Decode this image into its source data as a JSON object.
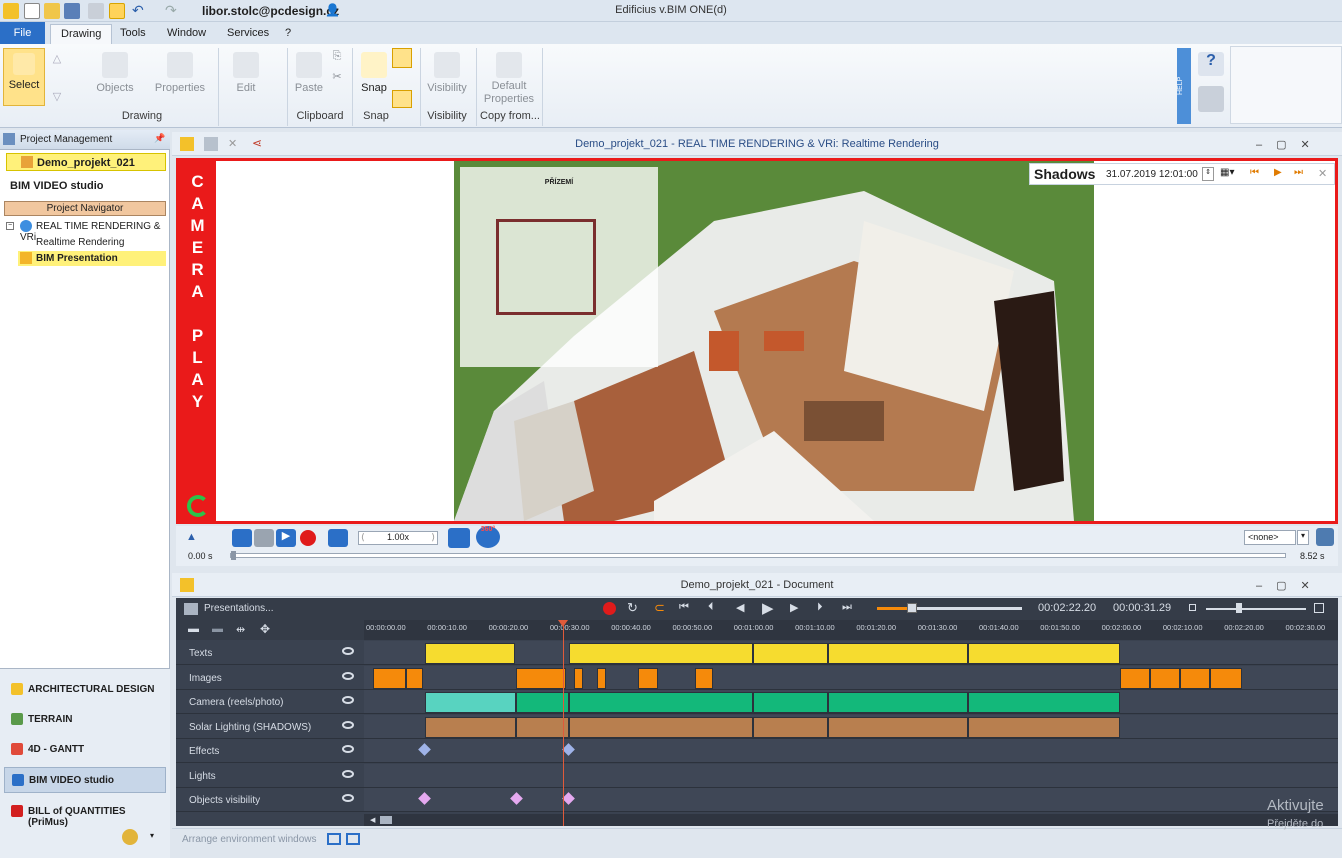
{
  "window": {
    "user_email": "libor.stolc@pcdesign.cz",
    "app_title": "Edificius v.BIM ONE(d)"
  },
  "menu": {
    "file": "File",
    "tabs": [
      "Drawing",
      "Tools",
      "Window",
      "Services",
      "?"
    ]
  },
  "ribbon": {
    "select": "Select",
    "objects": "Objects",
    "properties": "Properties",
    "edit": "Edit",
    "paste": "Paste",
    "snap": "Snap",
    "visibility": "Visibility",
    "default_properties_1": "Default",
    "default_properties_2": "Properties",
    "groups": {
      "drawing": "Drawing",
      "clipboard": "Clipboard",
      "snap": "Snap",
      "visibility": "Visibility",
      "copy_from": "Copy from..."
    },
    "help": "HELP"
  },
  "left_panel": {
    "header": "Project Management",
    "project": "Demo_projekt_021",
    "section": "BIM VIDEO studio",
    "navigator": "Project Navigator",
    "tree": [
      "REAL TIME RENDERING & VRi",
      "Realtime Rendering",
      "BIM Presentation"
    ],
    "modules": [
      "ARCHITECTURAL DESIGN",
      "TERRAIN",
      "4D - GANTT",
      "BIM VIDEO studio",
      "BILL of QUANTITIES (PriMus)"
    ]
  },
  "viewer": {
    "title": "Demo_projekt_021 -  REAL TIME RENDERING & VRi: Realtime Rendering",
    "camera_play": [
      "C",
      "A",
      "M",
      "E",
      "R",
      "A",
      "",
      "P",
      "L",
      "A",
      "Y"
    ],
    "shadows_label": "Shadows",
    "shadows_datetime": "31.07.2019  12:01:00",
    "floorplan_title": "PŘÍZEMÍ",
    "speed": "1.00x",
    "time_start": "0.00 s",
    "time_end": "8.52 s",
    "view_select": "<none>",
    "badge_360": "360°"
  },
  "timeline": {
    "title": "Demo_projekt_021 - Document",
    "presentations": "Presentations...",
    "time_current": "00:02:22.20",
    "time_total": "00:00:31.29",
    "ruler_labels": [
      "00:00:00.00",
      "00:00:10.00",
      "00:00:20.00",
      "00:00:30.00",
      "00:00:40.00",
      "00:00:50.00",
      "00:01:00.00",
      "00:01:10.00",
      "00:01:20.00",
      "00:01:30.00",
      "00:01:40.00",
      "00:01:50.00",
      "00:02:00.00",
      "00:02:10.00",
      "00:02:20.00",
      "00:02:30.00"
    ],
    "tracks": [
      "Texts",
      "Images",
      "Camera (reels/photo)",
      "Solar Lighting (SHADOWS)",
      "Effects",
      "Lights",
      "Objects visibility"
    ]
  },
  "status": {
    "arrange": "Arrange environment windows",
    "watermark_1": "Aktivujte",
    "watermark_2": "Přejděte do"
  },
  "colors": {
    "text_clip": "#f6dc2f",
    "image_clip": "#f58a0b",
    "camera_clip_light": "#58d3c0",
    "camera_clip": "#13b87a",
    "solar_clip": "#b87f4f",
    "diamond_effect": "#9fb3e8",
    "diamond_visibility": "#e5a9f0",
    "camera_border": "#ea1a1a"
  }
}
